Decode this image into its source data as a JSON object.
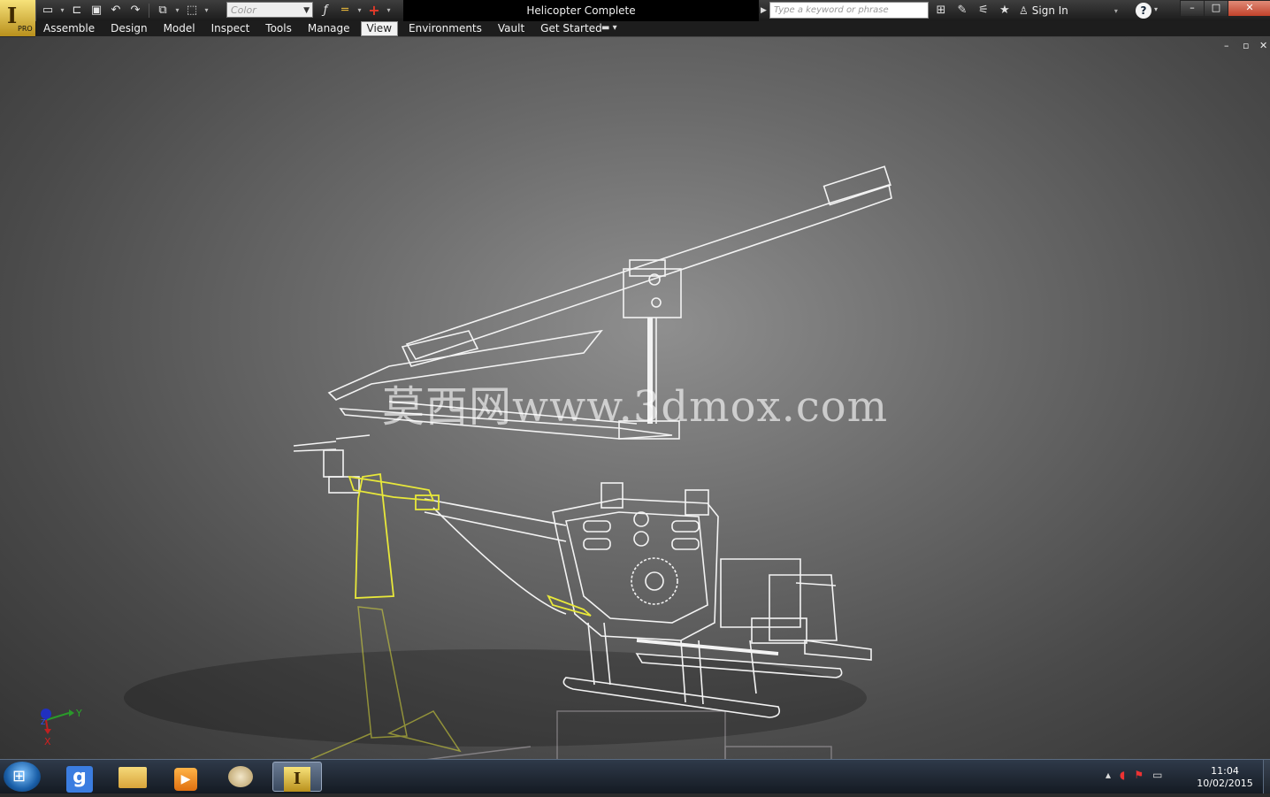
{
  "app": {
    "name": "Autodesk Inventor Professional",
    "badge": "PRO",
    "logo_glyph": "I"
  },
  "window": {
    "title": "Helicopter Complete"
  },
  "quick_access": {
    "icons": [
      "new-icon",
      "open-icon",
      "save-icon",
      "undo-icon",
      "redo-icon",
      "return-icon",
      "select-icon"
    ],
    "color_placeholder": "Color",
    "extra_icons": [
      "formula-icon",
      "line-weight-icon",
      "adjust-icon"
    ]
  },
  "search": {
    "placeholder": "Type a keyword or phrase"
  },
  "toolbar_right": {
    "icons": [
      "binoculars-icon",
      "wrench-icon",
      "satellite-icon",
      "star-icon"
    ],
    "sign_in": "Sign In"
  },
  "window_controls": {
    "minimize": "–",
    "maximize": "□",
    "close": "✕"
  },
  "ribbon": {
    "tabs": [
      "Assemble",
      "Design",
      "Model",
      "Inspect",
      "Tools",
      "Manage",
      "View",
      "Environments",
      "Vault",
      "Get Started"
    ],
    "active_tab": "View",
    "extra_icon": "camera-icon"
  },
  "viewport": {
    "controls": [
      "–",
      "▫",
      "✕"
    ],
    "watermark": "莫西网www.3dmox.com",
    "triad": {
      "y_label": "Y",
      "x_label": "X",
      "z_label": "Z"
    }
  },
  "colors": {
    "selected_highlight": "#e8e83a",
    "wire": "#f0f0f0",
    "close_button": "#c1422b"
  },
  "taskbar": {
    "items": [
      "chrome-icon",
      "explorer-icon",
      "media-player-icon",
      "paint-icon",
      "inventor-icon"
    ],
    "active_item": "inventor-icon",
    "tray_icons": [
      "show-hidden-icon",
      "volume-muted-icon",
      "action-center-icon",
      "network-icon"
    ],
    "time": "11:04",
    "date": "10/02/2015"
  }
}
